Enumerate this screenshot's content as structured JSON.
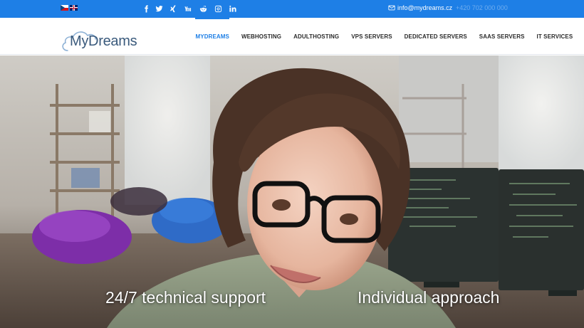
{
  "topbar": {
    "languages": [
      "cz",
      "en"
    ],
    "social": [
      "facebook-icon",
      "twitter-icon",
      "xing-icon",
      "youtube-icon",
      "reddit-icon",
      "instagram-icon",
      "linkedin-icon"
    ],
    "email": "info@mydreams.cz",
    "phone": "+420 702 000 000"
  },
  "brand": {
    "logo_text": "MyDreams",
    "accent": "#1e7fe6"
  },
  "nav": {
    "items": [
      {
        "label": "MYDREAMS",
        "active": true
      },
      {
        "label": "WEBHOSTING",
        "active": false
      },
      {
        "label": "ADULTHOSTING",
        "active": false
      },
      {
        "label": "VPS SERVERS",
        "active": false
      },
      {
        "label": "DEDICATED SERVERS",
        "active": false
      },
      {
        "label": "SAAS SERVERS",
        "active": false
      },
      {
        "label": "IT SERVICES",
        "active": false
      }
    ]
  },
  "hero": {
    "feature_1": "24/7 technical support",
    "feature_2": "Individual approach"
  }
}
